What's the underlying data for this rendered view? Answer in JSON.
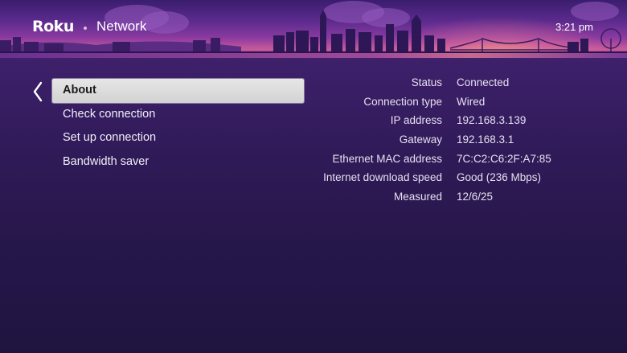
{
  "header": {
    "logo": "Roku",
    "title": "Network",
    "time": "3:21 pm"
  },
  "navigation": {
    "back_icon": "chevron-left-icon"
  },
  "menu": {
    "items": [
      {
        "label": "About",
        "selected": true
      },
      {
        "label": "Check connection",
        "selected": false
      },
      {
        "label": "Set up connection",
        "selected": false
      },
      {
        "label": "Bandwidth saver",
        "selected": false
      }
    ]
  },
  "info": {
    "rows": [
      {
        "label": "Status",
        "value": "Connected"
      },
      {
        "label": "Connection type",
        "value": "Wired"
      },
      {
        "label": "IP address",
        "value": "192.168.3.139"
      },
      {
        "label": "Gateway",
        "value": "192.168.3.1"
      },
      {
        "label": "Ethernet MAC address",
        "value": "7C:C2:C6:2F:A7:85"
      },
      {
        "label": "Internet download speed",
        "value": "Good (236 Mbps)"
      },
      {
        "label": "Measured",
        "value": "12/6/25"
      }
    ]
  },
  "colors": {
    "background_top": "#4a2478",
    "background_bottom": "#1f1440",
    "selected_bg": "#dcdcdc",
    "selected_text": "#1a1a1a",
    "text": "#e6e0f0"
  }
}
